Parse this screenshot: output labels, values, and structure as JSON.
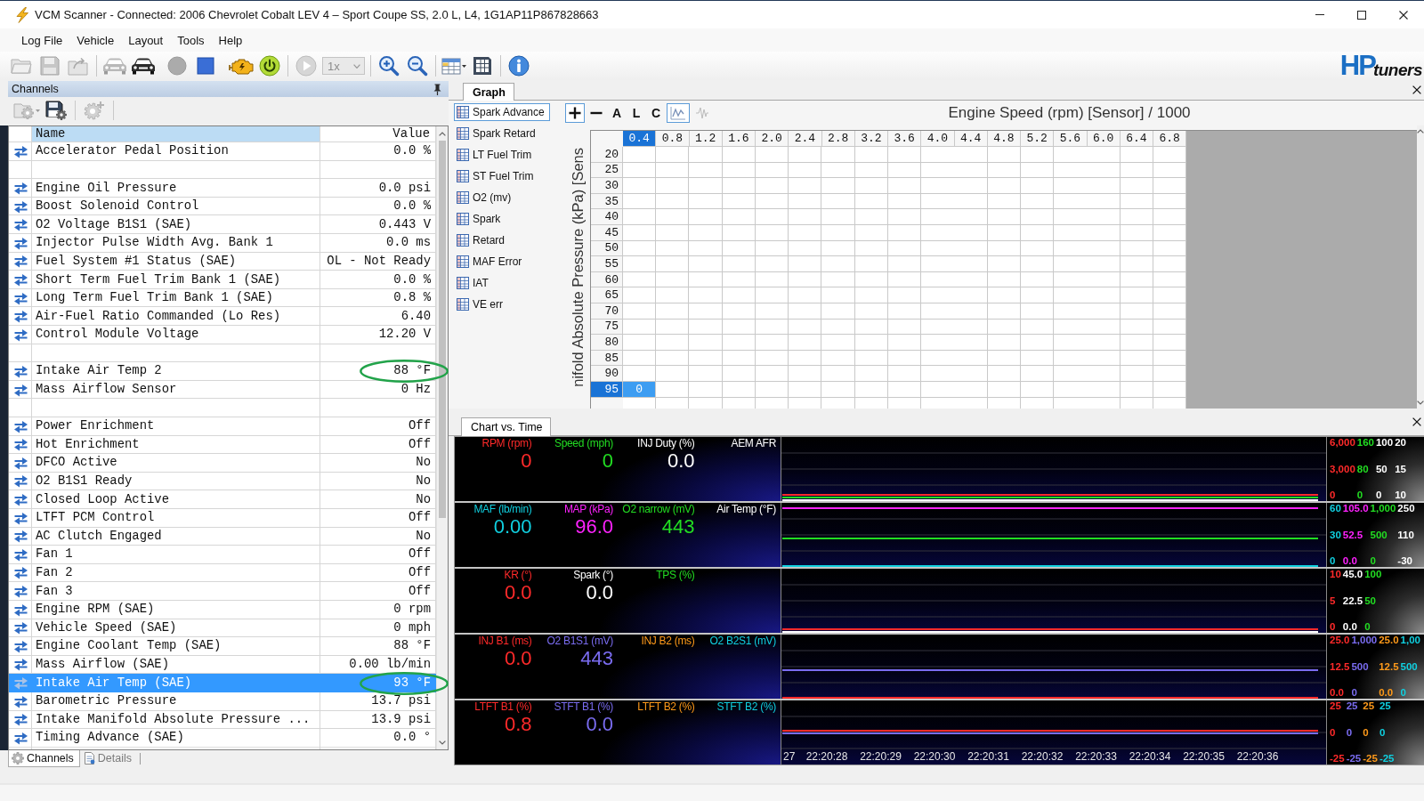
{
  "window": {
    "title": "VCM Scanner - Connected: 2006 Chevrolet Cobalt LEV 4 – Sport Coupe SS, 2.0 L, L4, 1G1AP11P867828663"
  },
  "menu": [
    "Log File",
    "Vehicle",
    "Layout",
    "Tools",
    "Help"
  ],
  "toolbar": {
    "groups": [
      [
        {
          "kind": "button",
          "disabled": true
        },
        {
          "kind": "button",
          "disabled": true
        },
        {
          "kind": "button",
          "disabled": true
        }
      ],
      [
        {
          "kind": "button",
          "disabled": true
        },
        {
          "kind": "button",
          "disabled": false
        },
        {
          "kind": "button",
          "disabled": true
        },
        {
          "kind": "button",
          "disabled": false
        },
        {
          "kind": "button",
          "disabled": false
        },
        {
          "kind": "button",
          "disabled": false
        }
      ],
      [
        {
          "kind": "button",
          "disabled": true
        },
        {
          "kind": "dropdown",
          "value": "1x",
          "disabled": true
        }
      ],
      [
        {
          "kind": "button",
          "disabled": false
        },
        {
          "kind": "button",
          "disabled": false
        }
      ],
      [
        {
          "kind": "button",
          "disabled": false
        },
        {
          "kind": "button",
          "disabled": false
        }
      ],
      [
        {
          "kind": "button",
          "disabled": false
        }
      ]
    ],
    "logo": {
      "mark": "HP",
      "word": "tuners"
    }
  },
  "channels_panel": {
    "title": "Channels",
    "toolbar": [
      {
        "disabled": true
      },
      {
        "disabled": false
      },
      {
        "disabled": true
      }
    ],
    "columns": [
      {
        "label": "Name",
        "selected": true
      },
      {
        "label": "Value",
        "selected": false
      }
    ],
    "rows": [
      {
        "kind": "channel",
        "name": "Accelerator Pedal Position",
        "value": "0.0 %",
        "selected": false,
        "circled": false
      },
      {
        "kind": "separator"
      },
      {
        "kind": "channel",
        "name": "Engine Oil Pressure",
        "value": "0.0 psi",
        "selected": false,
        "circled": false
      },
      {
        "kind": "channel",
        "name": "Boost Solenoid Control",
        "value": "0.0 %",
        "selected": false,
        "circled": false
      },
      {
        "kind": "channel",
        "name": "O2 Voltage B1S1 (SAE)",
        "value": "0.443 V",
        "selected": false,
        "circled": false
      },
      {
        "kind": "channel",
        "name": "Injector Pulse Width Avg. Bank 1",
        "value": "0.0 ms",
        "selected": false,
        "circled": false
      },
      {
        "kind": "channel",
        "name": "Fuel System #1 Status (SAE)",
        "value": "OL - Not Ready",
        "selected": false,
        "circled": false
      },
      {
        "kind": "channel",
        "name": "Short Term Fuel Trim Bank 1 (SAE)",
        "value": "0.0 %",
        "selected": false,
        "circled": false
      },
      {
        "kind": "channel",
        "name": "Long Term Fuel Trim Bank 1 (SAE)",
        "value": "0.8 %",
        "selected": false,
        "circled": false
      },
      {
        "kind": "channel",
        "name": "Air-Fuel Ratio Commanded (Lo Res)",
        "value": "6.40",
        "selected": false,
        "circled": false
      },
      {
        "kind": "channel",
        "name": "Control Module Voltage",
        "value": "12.20 V",
        "selected": false,
        "circled": false
      },
      {
        "kind": "separator"
      },
      {
        "kind": "channel",
        "name": "Intake Air Temp 2",
        "value": "88 °F",
        "selected": false,
        "circled": true
      },
      {
        "kind": "channel",
        "name": "Mass Airflow Sensor",
        "value": "0 Hz",
        "selected": false,
        "circled": false
      },
      {
        "kind": "separator"
      },
      {
        "kind": "channel",
        "name": "Power Enrichment",
        "value": "Off",
        "selected": false,
        "circled": false
      },
      {
        "kind": "channel",
        "name": "Hot Enrichment",
        "value": "Off",
        "selected": false,
        "circled": false
      },
      {
        "kind": "channel",
        "name": "DFCO Active",
        "value": "No",
        "selected": false,
        "circled": false
      },
      {
        "kind": "channel",
        "name": "O2 B1S1 Ready",
        "value": "No",
        "selected": false,
        "circled": false
      },
      {
        "kind": "channel",
        "name": "Closed Loop Active",
        "value": "No",
        "selected": false,
        "circled": false
      },
      {
        "kind": "channel",
        "name": "LTFT PCM Control",
        "value": "Off",
        "selected": false,
        "circled": false
      },
      {
        "kind": "channel",
        "name": "AC Clutch Engaged",
        "value": "No",
        "selected": false,
        "circled": false
      },
      {
        "kind": "channel",
        "name": "Fan 1",
        "value": "Off",
        "selected": false,
        "circled": false
      },
      {
        "kind": "channel",
        "name": "Fan 2",
        "value": "Off",
        "selected": false,
        "circled": false
      },
      {
        "kind": "channel",
        "name": "Fan 3",
        "value": "Off",
        "selected": false,
        "circled": false
      },
      {
        "kind": "channel",
        "name": "Engine RPM (SAE)",
        "value": "0 rpm",
        "selected": false,
        "circled": false
      },
      {
        "kind": "channel",
        "name": "Vehicle Speed (SAE)",
        "value": "0 mph",
        "selected": false,
        "circled": false
      },
      {
        "kind": "channel",
        "name": "Engine Coolant Temp (SAE)",
        "value": "88 °F",
        "selected": false,
        "circled": false
      },
      {
        "kind": "channel",
        "name": "Mass Airflow (SAE)",
        "value": "0.00 lb/min",
        "selected": false,
        "circled": false
      },
      {
        "kind": "channel",
        "name": "Intake Air Temp (SAE)",
        "value": "93 °F",
        "selected": true,
        "circled": true
      },
      {
        "kind": "channel",
        "name": "Barometric Pressure",
        "value": "13.7 psi",
        "selected": false,
        "circled": false
      },
      {
        "kind": "channel",
        "name": "Intake Manifold Absolute Pressure ...",
        "value": "13.9 psi",
        "selected": false,
        "circled": false
      },
      {
        "kind": "channel",
        "name": "Timing Advance (SAE)",
        "value": "0.0 °",
        "selected": false,
        "circled": false
      }
    ],
    "tabs": [
      {
        "label": "Channels",
        "selected": true
      },
      {
        "label": "Details",
        "selected": false
      }
    ]
  },
  "graph_panel": {
    "tab": "Graph",
    "tables": [
      {
        "label": "Spark Advance",
        "selected": true
      },
      {
        "label": "Spark Retard",
        "selected": false
      },
      {
        "label": "LT Fuel Trim",
        "selected": false
      },
      {
        "label": "ST Fuel Trim",
        "selected": false
      },
      {
        "label": "O2 (mv)",
        "selected": false
      },
      {
        "label": "Spark",
        "selected": false
      },
      {
        "label": "Retard",
        "selected": false
      },
      {
        "label": "MAF Error",
        "selected": false
      },
      {
        "label": "IAT",
        "selected": false
      },
      {
        "label": "VE err",
        "selected": false
      }
    ],
    "tools": [
      {
        "kind": "icon",
        "on": true,
        "disabled": false
      },
      {
        "kind": "icon",
        "on": false,
        "disabled": false
      },
      {
        "kind": "text",
        "label": "A",
        "on": false,
        "disabled": false
      },
      {
        "kind": "text",
        "label": "L",
        "on": false,
        "disabled": false
      },
      {
        "kind": "text",
        "label": "C",
        "on": false,
        "disabled": false
      },
      {
        "kind": "icon",
        "on": true,
        "disabled": false
      },
      {
        "kind": "icon",
        "on": false,
        "disabled": true
      }
    ],
    "title": "Engine Speed (rpm) [Sensor] / 1000",
    "y_axis_label": "nifold Absolute Pressure (kPa) [Sens",
    "columns": [
      {
        "label": "0.4",
        "selected": true
      },
      {
        "label": "0.8",
        "selected": false
      },
      {
        "label": "1.2",
        "selected": false
      },
      {
        "label": "1.6",
        "selected": false
      },
      {
        "label": "2.0",
        "selected": false
      },
      {
        "label": "2.4",
        "selected": false
      },
      {
        "label": "2.8",
        "selected": false
      },
      {
        "label": "3.2",
        "selected": false
      },
      {
        "label": "3.6",
        "selected": false
      },
      {
        "label": "4.0",
        "selected": false
      },
      {
        "label": "4.4",
        "selected": false
      },
      {
        "label": "4.8",
        "selected": false
      },
      {
        "label": "5.2",
        "selected": false
      },
      {
        "label": "5.6",
        "selected": false
      },
      {
        "label": "6.0",
        "selected": false
      },
      {
        "label": "6.4",
        "selected": false
      },
      {
        "label": "6.8",
        "selected": false
      }
    ],
    "rows": [
      {
        "label": "20",
        "selected": false
      },
      {
        "label": "25",
        "selected": false
      },
      {
        "label": "30",
        "selected": false
      },
      {
        "label": "35",
        "selected": false
      },
      {
        "label": "40",
        "selected": false
      },
      {
        "label": "45",
        "selected": false
      },
      {
        "label": "50",
        "selected": false
      },
      {
        "label": "55",
        "selected": false
      },
      {
        "label": "60",
        "selected": false
      },
      {
        "label": "65",
        "selected": false
      },
      {
        "label": "70",
        "selected": false
      },
      {
        "label": "75",
        "selected": false
      },
      {
        "label": "80",
        "selected": false
      },
      {
        "label": "85",
        "selected": false
      },
      {
        "label": "90",
        "selected": false
      },
      {
        "label": "95",
        "selected": true,
        "cells": [
          "0"
        ]
      }
    ]
  },
  "chart_panel": {
    "tab": "Chart vs. Time",
    "strips": [
      {
        "gauges": [
          {
            "label": "RPM (rpm)",
            "value": "0",
            "color": "#ff2a2a"
          },
          {
            "label": "Speed (mph)",
            "value": "0",
            "color": "#22dd22"
          },
          {
            "label": "INJ Duty (%)",
            "value": "0.0",
            "color": "#ffffff"
          },
          {
            "label": "AEM AFR",
            "color": "#ffffff"
          }
        ],
        "scales": [
          {
            "color": "#ff2a2a",
            "ticks": [
              "6,000",
              "3,000",
              "0"
            ]
          },
          {
            "color": "#22dd22",
            "ticks": [
              "160",
              "80",
              "0"
            ]
          },
          {
            "color": "#ffffff",
            "ticks": [
              "100",
              "50",
              "0"
            ]
          },
          {
            "color": "#ffffff",
            "ticks": [
              "20",
              "15",
              "10"
            ]
          }
        ]
      },
      {
        "gauges": [
          {
            "label": "MAF (lb/min)",
            "value": "0.00",
            "color": "#10d0e0"
          },
          {
            "label": "MAP (kPa)",
            "value": "96.0",
            "color": "#ff22ff"
          },
          {
            "label": "O2 narrow (mV)",
            "value": "443",
            "color": "#22dd22"
          },
          {
            "label": "Air Temp (°F)",
            "color": "#ffffff"
          }
        ],
        "scales": [
          {
            "color": "#10d0e0",
            "ticks": [
              "60",
              "30",
              "0"
            ]
          },
          {
            "color": "#ff22ff",
            "ticks": [
              "105.0",
              "52.5",
              "0.0"
            ]
          },
          {
            "color": "#22dd22",
            "ticks": [
              "1,000",
              "500",
              "0"
            ]
          },
          {
            "color": "#ffffff",
            "ticks": [
              "250",
              "110",
              "-30"
            ]
          }
        ]
      },
      {
        "gauges": [
          {
            "label": "KR (°)",
            "value": "0.0",
            "color": "#ff2a2a"
          },
          {
            "label": "Spark (°)",
            "value": "0.0",
            "color": "#ffffff"
          },
          {
            "label": "TPS (%)",
            "color": "#22dd22"
          }
        ],
        "scales": [
          {
            "color": "#ff2a2a",
            "ticks": [
              "10",
              "5",
              "0"
            ]
          },
          {
            "color": "#ffffff",
            "ticks": [
              "45.0",
              "22.5",
              "0.0"
            ]
          },
          {
            "color": "#22dd22",
            "ticks": [
              "100",
              "50",
              "0"
            ]
          }
        ]
      },
      {
        "gauges": [
          {
            "label": "INJ B1 (ms)",
            "value": "0.0",
            "color": "#ff2a2a"
          },
          {
            "label": "O2 B1S1 (mV)",
            "value": "443",
            "color": "#7a6cf0"
          },
          {
            "label": "INJ B2 (ms)",
            "color": "#ff9a1a"
          },
          {
            "label": "O2 B2S1 (mV)",
            "color": "#10d0e0"
          }
        ],
        "scales": [
          {
            "color": "#ff2a2a",
            "ticks": [
              "25.0",
              "12.5",
              "0.0"
            ]
          },
          {
            "color": "#7a6cf0",
            "ticks": [
              "1,000",
              "500",
              "0"
            ]
          },
          {
            "color": "#ff9a1a",
            "ticks": [
              "25.0",
              "12.5",
              "0.0"
            ]
          },
          {
            "color": "#10d0e0",
            "ticks": [
              "1,00",
              "500",
              "0"
            ]
          }
        ]
      },
      {
        "gauges": [
          {
            "label": "LTFT B1 (%)",
            "value": "0.8",
            "color": "#ff2a2a"
          },
          {
            "label": "STFT B1 (%)",
            "value": "0.0",
            "color": "#7a6cf0"
          },
          {
            "label": "LTFT B2 (%)",
            "color": "#ff9a1a"
          },
          {
            "label": "STFT B2 (%)",
            "color": "#10d0e0"
          }
        ],
        "scales": [
          {
            "color": "#ff2a2a",
            "ticks": [
              "25",
              "0",
              "-25"
            ]
          },
          {
            "color": "#7a6cf0",
            "ticks": [
              "25",
              "0",
              "-25"
            ]
          },
          {
            "color": "#ff9a1a",
            "ticks": [
              "25",
              "0",
              "-25"
            ]
          },
          {
            "color": "#10d0e0",
            "ticks": [
              "25",
              "0",
              "-25"
            ]
          }
        ]
      }
    ],
    "time_labels": [
      "27",
      "22:20:28",
      "22:20:29",
      "22:20:30",
      "22:20:31",
      "22:20:32",
      "22:20:33",
      "22:20:34",
      "22:20:35",
      "22:20:36"
    ]
  }
}
